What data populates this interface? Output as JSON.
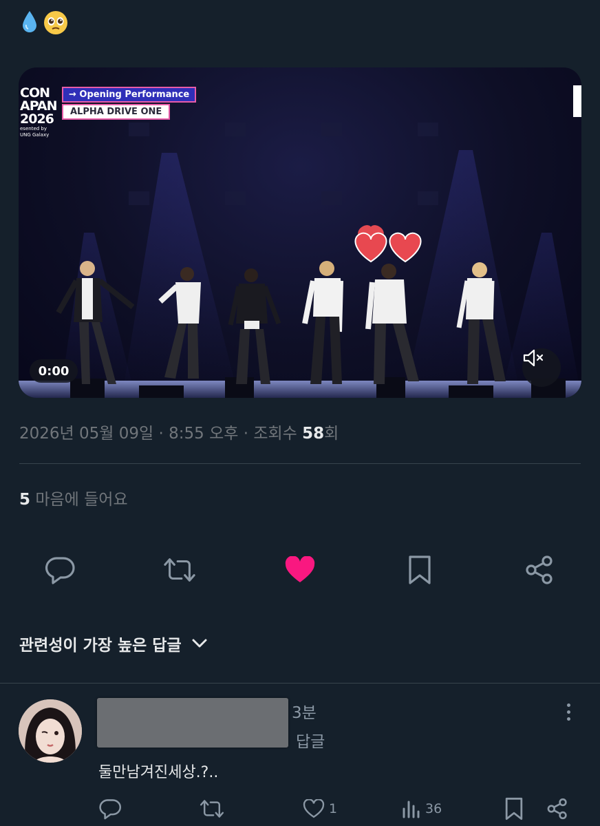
{
  "post": {
    "emoji": [
      "💧",
      "🥹"
    ],
    "video": {
      "logo_line1": "CON",
      "logo_line2": "APAN",
      "logo_line3": "2026",
      "logo_sub1": "esented by",
      "logo_sub2": "UNG Galaxy",
      "tag_top": "→ Opening Performance",
      "tag_bottom": "ALPHA DRIVE ONE",
      "time": "0:00",
      "mute_icon": "speaker-muted-icon"
    },
    "meta": {
      "date": "2026년 05월 09일",
      "sep1": " · ",
      "time": "8:55 오후",
      "sep2": " · ",
      "views_prefix": "조회수 ",
      "views_count": "58",
      "views_suffix": "회"
    },
    "likes": {
      "count": "5",
      "label": "마음에 들어요"
    },
    "actions": [
      "reply-icon",
      "repost-icon",
      "like-icon",
      "bookmark-icon",
      "share-icon"
    ],
    "like_color": "#f91880"
  },
  "replies_sort": {
    "label": "관련성이 가장 높은 답글"
  },
  "reply": {
    "time_partial": "3분",
    "reply_to_partial": "답글",
    "text": "둘만남겨진세상.?..",
    "like_count": "1",
    "view_count": "36"
  },
  "colors": {
    "background": "#15202b",
    "text": "#e7e9ea",
    "muted": "#71767b",
    "accent_like": "#f91880"
  }
}
